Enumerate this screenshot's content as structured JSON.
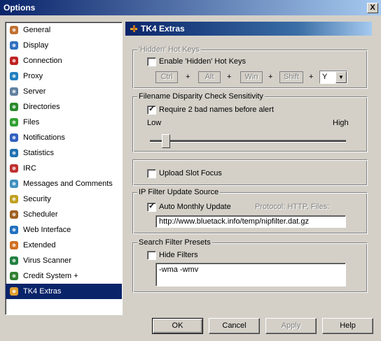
{
  "window": {
    "title": "Options",
    "close_glyph": "X"
  },
  "sidebar": {
    "items": [
      {
        "label": "General",
        "icon": "gear-icon",
        "color": "#c07030"
      },
      {
        "label": "Display",
        "icon": "monitor-icon",
        "color": "#3070c0"
      },
      {
        "label": "Connection",
        "icon": "plug-icon",
        "color": "#c02020"
      },
      {
        "label": "Proxy",
        "icon": "globe-icon",
        "color": "#2080c0"
      },
      {
        "label": "Server",
        "icon": "server-icon",
        "color": "#6080a0"
      },
      {
        "label": "Directories",
        "icon": "folder-icon",
        "color": "#2a8a2a"
      },
      {
        "label": "Files",
        "icon": "files-icon",
        "color": "#30a030"
      },
      {
        "label": "Notifications",
        "icon": "bell-icon",
        "color": "#3060c0"
      },
      {
        "label": "Statistics",
        "icon": "chart-icon",
        "color": "#2070b0"
      },
      {
        "label": "IRC",
        "icon": "irc-icon",
        "color": "#c03030"
      },
      {
        "label": "Messages and Comments",
        "icon": "message-icon",
        "color": "#4090c0"
      },
      {
        "label": "Security",
        "icon": "lock-icon",
        "color": "#c0a020"
      },
      {
        "label": "Scheduler",
        "icon": "calendar-icon",
        "color": "#a06020"
      },
      {
        "label": "Web Interface",
        "icon": "web-icon",
        "color": "#2070c0"
      },
      {
        "label": "Extended",
        "icon": "puzzle-icon",
        "color": "#d07020"
      },
      {
        "label": "Virus Scanner",
        "icon": "shield-icon",
        "color": "#208040"
      },
      {
        "label": "Credit System +",
        "icon": "credit-icon",
        "color": "#308030"
      },
      {
        "label": "TK4 Extras",
        "icon": "tools-icon",
        "color": "#e0a030"
      }
    ]
  },
  "panel": {
    "title": "TK4 Extras",
    "hotkeys": {
      "legend": "'Hidden' Hot Keys",
      "enable_label": "Enable 'Hidden' Hot Keys",
      "keys": [
        "Ctrl",
        "Alt",
        "Win",
        "Shift"
      ],
      "plus": "+",
      "letter_value": "Y"
    },
    "disparity": {
      "legend": "Filename Disparity Check Sensitivity",
      "require_label": "Require 2 bad names before alert",
      "low_label": "Low",
      "high_label": "High",
      "slider_fraction": 0.06
    },
    "upload": {
      "label": "Upload Slot Focus"
    },
    "ipfilter": {
      "legend": "IP Filter Update Source",
      "auto_label": "Auto Monthly Update",
      "protocol_text": "Protocol: HTTP, Files:",
      "url": "http://www.bluetack.info/temp/nipfilter.dat.gz"
    },
    "search": {
      "legend": "Search Filter Presets",
      "hide_label": "Hide Filters",
      "filters_text": "-wma -wmv"
    }
  },
  "buttons": {
    "ok": "OK",
    "cancel": "Cancel",
    "apply": "Apply",
    "help": "Help"
  }
}
